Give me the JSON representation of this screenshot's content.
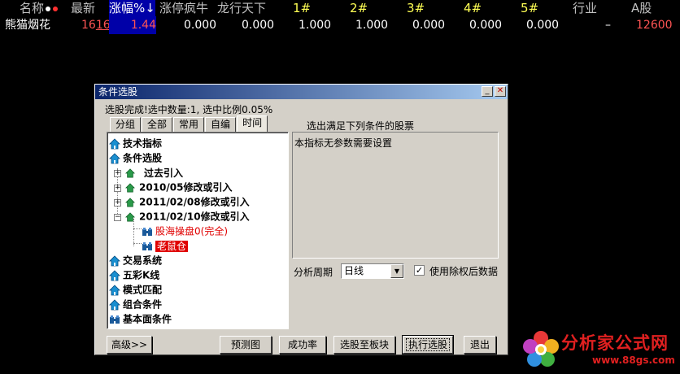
{
  "header": {
    "cols": [
      "名称",
      "最新",
      "涨幅%↓",
      "涨停疯牛",
      "龙行天下",
      "1#",
      "2#",
      "3#",
      "4#",
      "5#",
      "行业",
      "A股"
    ]
  },
  "row": {
    "name": "熊猫烟花",
    "latest_prefix": "16",
    "latest_suffix": "16",
    "change": "1.44",
    "c1": "0.000",
    "c2": "0.000",
    "c3": "1.000",
    "c4": "1.000",
    "c5": "0.000",
    "c6": "0.000",
    "c7": "0.000",
    "industry": "–",
    "ashare": "12600"
  },
  "dialog": {
    "title": "条件选股",
    "status": "选股完成!选中数量:1, 选中比例0.05%",
    "tabs": [
      "分组",
      "全部",
      "常用",
      "自编",
      "时间"
    ],
    "active_tab": "时间",
    "tree": {
      "tech": "技术指标",
      "cond": "条件选股",
      "past": "过去引入",
      "d1": "2010/05修改或引入",
      "d2": "2011/02/08修改或引入",
      "d3": "2011/02/10修改或引入",
      "leaf1": "股海操盘0(完全)",
      "leaf2": "老鼠仓",
      "trade": "交易系统",
      "five": "五彩K线",
      "pattern": "模式匹配",
      "combo": "组合条件",
      "fund": "基本面条件"
    },
    "right_label": "选出满足下列条件的股票",
    "no_params": "本指标无参数需要设置",
    "period_label": "分析周期",
    "period_value": "日线",
    "checkbox_label": "使用除权后数据",
    "checkbox_checked": "✓",
    "buttons": {
      "advanced": "高级>>",
      "preview": "预测图",
      "success": "成功率",
      "to_block": "选股至板块",
      "execute": "执行选股",
      "exit": "退出"
    }
  },
  "logo": {
    "brand": "分析家公式网",
    "url": "www.88gs.com"
  },
  "colors": {
    "accent_blue": "#0000a8",
    "up_red": "#ff5454",
    "title_gradient_start": "#0a246a",
    "dialog_bg": "#d4d0c8"
  }
}
